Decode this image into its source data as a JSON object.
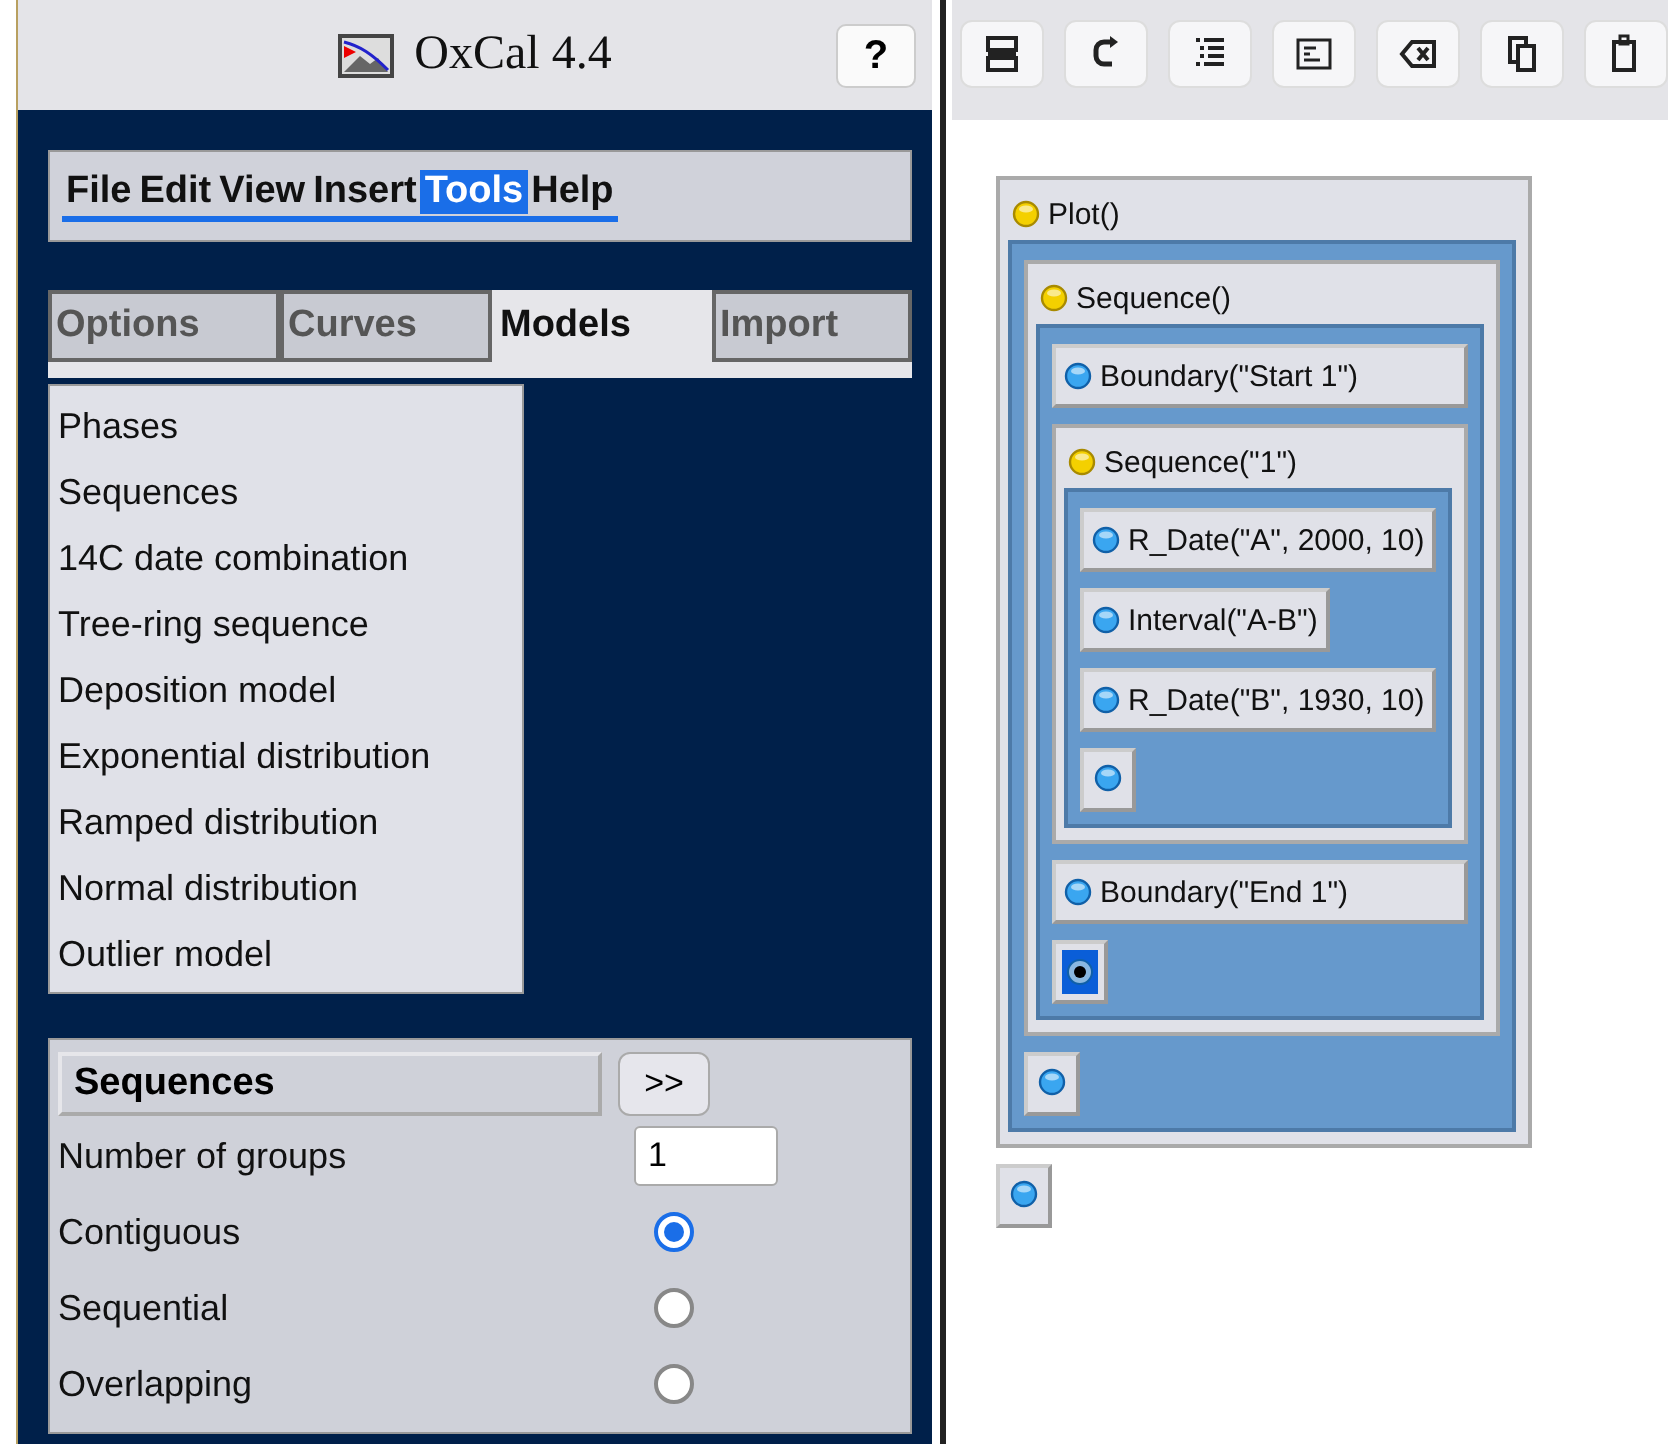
{
  "app": {
    "title": "OxCal 4.4",
    "help_button": "?"
  },
  "menu": [
    {
      "label": "File",
      "selected": false
    },
    {
      "label": "Edit",
      "selected": false
    },
    {
      "label": "View",
      "selected": false
    },
    {
      "label": "Insert",
      "selected": false
    },
    {
      "label": "Tools",
      "selected": true
    },
    {
      "label": "Help",
      "selected": false
    }
  ],
  "tabs": [
    {
      "label": "Options",
      "selected": false
    },
    {
      "label": "Curves",
      "selected": false
    },
    {
      "label": "Models",
      "selected": true
    },
    {
      "label": "Import",
      "selected": false
    }
  ],
  "models": [
    "Phases",
    "Sequences",
    "14C date combination",
    "Tree-ring sequence",
    "Deposition model",
    "Exponential distribution",
    "Ramped distribution",
    "Normal distribution",
    "Outlier model"
  ],
  "options_panel": {
    "title": "Sequences",
    "expand_button": ">>",
    "field": {
      "label": "Number of groups",
      "value": "1"
    },
    "radios": [
      {
        "label": "Contiguous",
        "selected": true
      },
      {
        "label": "Sequential",
        "selected": false
      },
      {
        "label": "Overlapping",
        "selected": false
      }
    ]
  },
  "tree": [
    {
      "kind": "group",
      "label": "Plot()",
      "children": [
        {
          "kind": "group",
          "label": "Sequence()",
          "children": [
            {
              "kind": "item",
              "label": "Boundary(\"Start 1\")"
            },
            {
              "kind": "group",
              "label": "Sequence(\"1\")",
              "children": [
                {
                  "kind": "item",
                  "label": "R_Date(\"A\", 2000, 10)"
                },
                {
                  "kind": "item",
                  "label": "Interval(\"A-B\")"
                },
                {
                  "kind": "item",
                  "label": "R_Date(\"B\", 1930, 10)"
                },
                {
                  "kind": "slot",
                  "selected": false
                }
              ]
            },
            {
              "kind": "item",
              "label": "Boundary(\"End 1\")"
            },
            {
              "kind": "slot",
              "selected": true
            }
          ]
        },
        {
          "kind": "slot",
          "selected": false
        }
      ]
    },
    {
      "kind": "slot",
      "selected": false
    }
  ]
}
